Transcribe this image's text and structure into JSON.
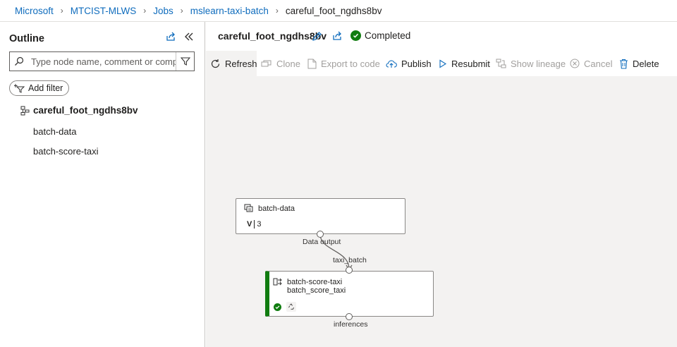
{
  "breadcrumb": {
    "items": [
      "Microsoft",
      "MTCIST-MLWS",
      "Jobs",
      "mslearn-taxi-batch"
    ],
    "current": "careful_foot_ngdhs8bv"
  },
  "outline": {
    "title": "Outline",
    "search_placeholder": "Type node name, comment or component",
    "add_filter_label": "Add filter",
    "root_label": "careful_foot_ngdhs8bv",
    "items": [
      "batch-data",
      "batch-score-taxi"
    ]
  },
  "job": {
    "name": "careful_foot_ngdhs8bv",
    "status": "Completed",
    "status_color": "#107c10"
  },
  "toolbar": {
    "refresh": "Refresh",
    "clone": "Clone",
    "export": "Export to code",
    "publish": "Publish",
    "resubmit": "Resubmit",
    "lineage": "Show lineage",
    "cancel": "Cancel",
    "delete": "Delete"
  },
  "graph": {
    "data_node": {
      "title": "batch-data",
      "version_badge": "V",
      "version": "3",
      "output_port": "Data output"
    },
    "score_node": {
      "title": "batch-score-taxi",
      "subtitle": "batch_score_taxi",
      "input_port": "taxi_batch",
      "output_port": "inferences",
      "status_color": "#107c10"
    }
  },
  "colors": {
    "link": "#0f6cbd",
    "accent_green": "#107c10",
    "canvas_bg": "#f3f2f1"
  }
}
